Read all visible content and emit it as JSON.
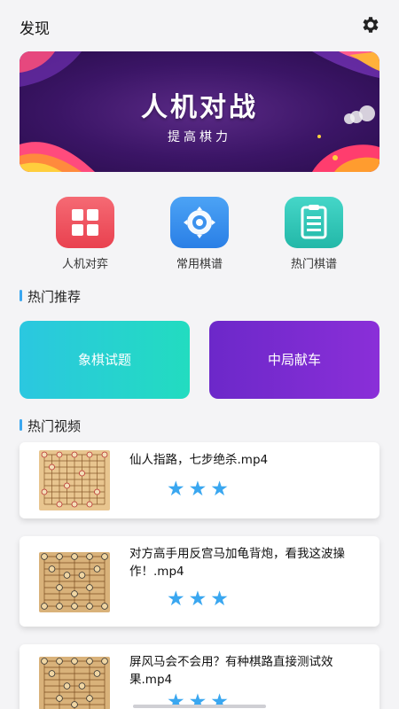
{
  "header": {
    "title": "发现"
  },
  "banner": {
    "title": "人机对战",
    "subtitle": "提高棋力"
  },
  "quick_actions": [
    {
      "label": "人机对弈",
      "icon": "grid-icon",
      "color": "#ee4d5a"
    },
    {
      "label": "常用棋谱",
      "icon": "target-icon",
      "color": "#2d8ef0"
    },
    {
      "label": "热门棋谱",
      "icon": "document-icon",
      "color": "#2ec4b6"
    }
  ],
  "recommend": {
    "section_title": "热门推荐",
    "cards": [
      {
        "label": "象棋试题"
      },
      {
        "label": "中局献车"
      }
    ]
  },
  "videos": {
    "section_title": "热门视频",
    "items": [
      {
        "title": "仙人指路，七步绝杀.mp4",
        "rating": 3
      },
      {
        "title": "对方高手用反宫马加龟背炮，看我这波操作！.mp4",
        "rating": 3
      },
      {
        "title": "屏风马会不会用？有种棋路直接测试效果.mp4",
        "rating": 3
      }
    ]
  },
  "colors": {
    "accent": "#3aa7f0",
    "banner_bg": "#3b1566"
  }
}
